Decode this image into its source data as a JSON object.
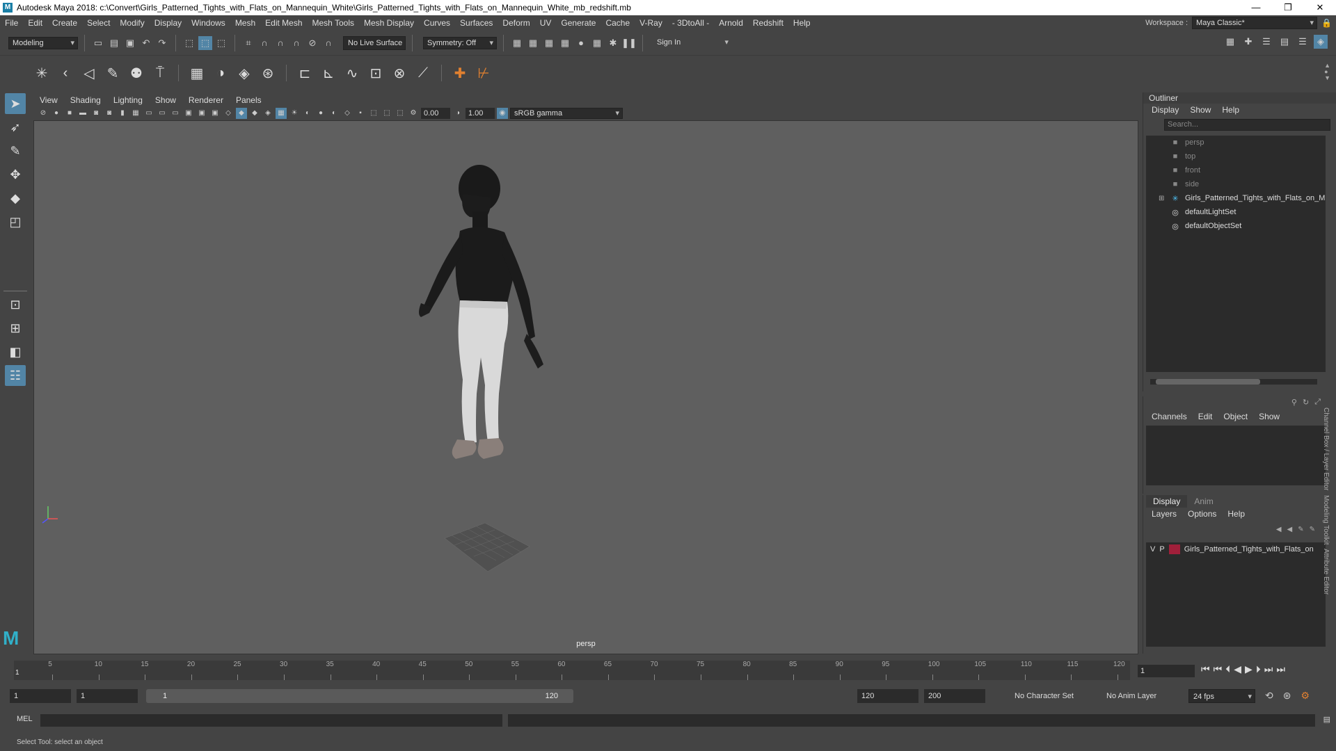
{
  "window": {
    "title": "Autodesk Maya 2018: c:\\Convert\\Girls_Patterned_Tights_with_Flats_on_Mannequin_White\\Girls_Patterned_Tights_with_Flats_on_Mannequin_White_mb_redshift.mb",
    "minimize": "—",
    "restore": "❐",
    "close": "✕"
  },
  "menubar": [
    "File",
    "Edit",
    "Create",
    "Select",
    "Modify",
    "Display",
    "Windows",
    "Mesh",
    "Edit Mesh",
    "Mesh Tools",
    "Mesh Display",
    "Curves",
    "Surfaces",
    "Deform",
    "UV",
    "Generate",
    "Cache",
    "V-Ray",
    "- 3DtoAll -",
    "Arnold",
    "Redshift",
    "Help"
  ],
  "workspace": {
    "label": "Workspace :",
    "value": "Maya Classic*"
  },
  "statusline": {
    "mode": "Modeling",
    "live_surface": "No Live Surface",
    "symmetry": "Symmetry: Off",
    "sign_in": "Sign In"
  },
  "viewport": {
    "menu": [
      "View",
      "Shading",
      "Lighting",
      "Show",
      "Renderer",
      "Panels"
    ],
    "exposure": "0.00",
    "gamma": "1.00",
    "color_space": "sRGB gamma",
    "camera": "persp"
  },
  "outliner": {
    "title": "Outliner",
    "menu": [
      "Display",
      "Show",
      "Help"
    ],
    "search_placeholder": "Search...",
    "items": [
      {
        "label": "persp",
        "icon": "camera-icon"
      },
      {
        "label": "top",
        "icon": "camera-icon"
      },
      {
        "label": "front",
        "icon": "camera-icon"
      },
      {
        "label": "side",
        "icon": "camera-icon"
      },
      {
        "label": "Girls_Patterned_Tights_with_Flats_on_M",
        "icon": "group-icon"
      },
      {
        "label": "defaultLightSet",
        "icon": "set-icon"
      },
      {
        "label": "defaultObjectSet",
        "icon": "set-icon"
      }
    ]
  },
  "channelbox": {
    "menu": [
      "Channels",
      "Edit",
      "Object",
      "Show"
    ]
  },
  "layereditor": {
    "tabs": [
      "Display",
      "Anim"
    ],
    "menu": [
      "Layers",
      "Options",
      "Help"
    ],
    "layer": {
      "v": "V",
      "p": "P",
      "name": "Girls_Patterned_Tights_with_Flats_on"
    }
  },
  "side_tabs": [
    "Channel Box / Layer Editor",
    "Modeling Toolkit",
    "Attribute Editor"
  ],
  "timeslider": {
    "ticks": [
      "5",
      "10",
      "15",
      "20",
      "25",
      "30",
      "35",
      "40",
      "45",
      "50",
      "55",
      "60",
      "65",
      "70",
      "75",
      "80",
      "85",
      "90",
      "95",
      "100",
      "105",
      "110",
      "115",
      "120"
    ],
    "current_marker": "1",
    "current_frame": "1"
  },
  "rangeslider": {
    "start": "1",
    "playback_start": "1",
    "range_start_label": "1",
    "range_end_label": "120",
    "playback_end": "120",
    "end": "200",
    "character_set": "No Character Set",
    "anim_layer": "No Anim Layer",
    "fps": "24 fps"
  },
  "cmdline": {
    "label": "MEL"
  },
  "helpline": {
    "text": "Select Tool: select an object"
  },
  "colors": {
    "accent": "#5285a6",
    "layer_color": "#a01f3a",
    "viewport_bg": "#5f5f5f"
  }
}
